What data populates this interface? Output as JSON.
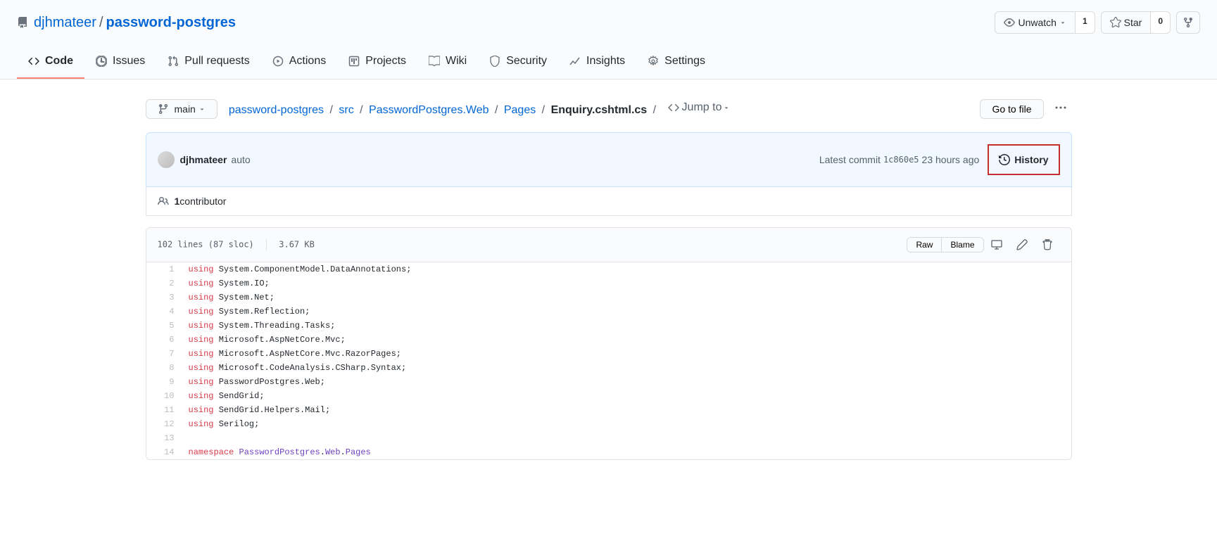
{
  "repo": {
    "owner": "djhmateer",
    "name": "password-postgres"
  },
  "actions": {
    "unwatch": "Unwatch",
    "unwatch_count": "1",
    "star": "Star",
    "star_count": "0"
  },
  "nav": {
    "code": "Code",
    "issues": "Issues",
    "pulls": "Pull requests",
    "actions": "Actions",
    "projects": "Projects",
    "wiki": "Wiki",
    "security": "Security",
    "insights": "Insights",
    "settings": "Settings"
  },
  "branch": "main",
  "breadcrumb": {
    "root": "password-postgres",
    "p1": "src",
    "p2": "PasswordPostgres.Web",
    "p3": "Pages",
    "file": "Enquiry.cshtml.cs",
    "jump": "Jump to"
  },
  "goto": "Go to file",
  "commit": {
    "author": "djhmateer",
    "message": "auto",
    "latest_label": "Latest commit",
    "hash": "1c860e5",
    "time": "23 hours ago",
    "history": "History"
  },
  "contributors": {
    "count": "1",
    "label": " contributor"
  },
  "file": {
    "lines": "102 lines (87 sloc)",
    "size": "3.67 KB",
    "raw": "Raw",
    "blame": "Blame"
  },
  "code_lines": [
    [
      [
        "k",
        "using"
      ],
      [
        "p",
        " "
      ],
      [
        "n",
        "System"
      ],
      [
        "p",
        "."
      ],
      [
        "n",
        "ComponentModel"
      ],
      [
        "p",
        "."
      ],
      [
        "n",
        "DataAnnotations"
      ],
      [
        "p",
        ";"
      ]
    ],
    [
      [
        "k",
        "using"
      ],
      [
        "p",
        " "
      ],
      [
        "n",
        "System"
      ],
      [
        "p",
        "."
      ],
      [
        "n",
        "IO"
      ],
      [
        "p",
        ";"
      ]
    ],
    [
      [
        "k",
        "using"
      ],
      [
        "p",
        " "
      ],
      [
        "n",
        "System"
      ],
      [
        "p",
        "."
      ],
      [
        "n",
        "Net"
      ],
      [
        "p",
        ";"
      ]
    ],
    [
      [
        "k",
        "using"
      ],
      [
        "p",
        " "
      ],
      [
        "n",
        "System"
      ],
      [
        "p",
        "."
      ],
      [
        "n",
        "Reflection"
      ],
      [
        "p",
        ";"
      ]
    ],
    [
      [
        "k",
        "using"
      ],
      [
        "p",
        " "
      ],
      [
        "n",
        "System"
      ],
      [
        "p",
        "."
      ],
      [
        "n",
        "Threading"
      ],
      [
        "p",
        "."
      ],
      [
        "n",
        "Tasks"
      ],
      [
        "p",
        ";"
      ]
    ],
    [
      [
        "k",
        "using"
      ],
      [
        "p",
        " "
      ],
      [
        "n",
        "Microsoft"
      ],
      [
        "p",
        "."
      ],
      [
        "n",
        "AspNetCore"
      ],
      [
        "p",
        "."
      ],
      [
        "n",
        "Mvc"
      ],
      [
        "p",
        ";"
      ]
    ],
    [
      [
        "k",
        "using"
      ],
      [
        "p",
        " "
      ],
      [
        "n",
        "Microsoft"
      ],
      [
        "p",
        "."
      ],
      [
        "n",
        "AspNetCore"
      ],
      [
        "p",
        "."
      ],
      [
        "n",
        "Mvc"
      ],
      [
        "p",
        "."
      ],
      [
        "n",
        "RazorPages"
      ],
      [
        "p",
        ";"
      ]
    ],
    [
      [
        "k",
        "using"
      ],
      [
        "p",
        " "
      ],
      [
        "n",
        "Microsoft"
      ],
      [
        "p",
        "."
      ],
      [
        "n",
        "CodeAnalysis"
      ],
      [
        "p",
        "."
      ],
      [
        "n",
        "CSharp"
      ],
      [
        "p",
        "."
      ],
      [
        "n",
        "Syntax"
      ],
      [
        "p",
        ";"
      ]
    ],
    [
      [
        "k",
        "using"
      ],
      [
        "p",
        " "
      ],
      [
        "n",
        "PasswordPostgres"
      ],
      [
        "p",
        "."
      ],
      [
        "n",
        "Web"
      ],
      [
        "p",
        ";"
      ]
    ],
    [
      [
        "k",
        "using"
      ],
      [
        "p",
        " "
      ],
      [
        "n",
        "SendGrid"
      ],
      [
        "p",
        ";"
      ]
    ],
    [
      [
        "k",
        "using"
      ],
      [
        "p",
        " "
      ],
      [
        "n",
        "SendGrid"
      ],
      [
        "p",
        "."
      ],
      [
        "n",
        "Helpers"
      ],
      [
        "p",
        "."
      ],
      [
        "n",
        "Mail"
      ],
      [
        "p",
        ";"
      ]
    ],
    [
      [
        "k",
        "using"
      ],
      [
        "p",
        " "
      ],
      [
        "n",
        "Serilog"
      ],
      [
        "p",
        ";"
      ]
    ],
    [],
    [
      [
        "k",
        "namespace"
      ],
      [
        "p",
        " "
      ],
      [
        "nn",
        "PasswordPostgres"
      ],
      [
        "p",
        "."
      ],
      [
        "nn",
        "Web"
      ],
      [
        "p",
        "."
      ],
      [
        "nn",
        "Pages"
      ]
    ]
  ]
}
